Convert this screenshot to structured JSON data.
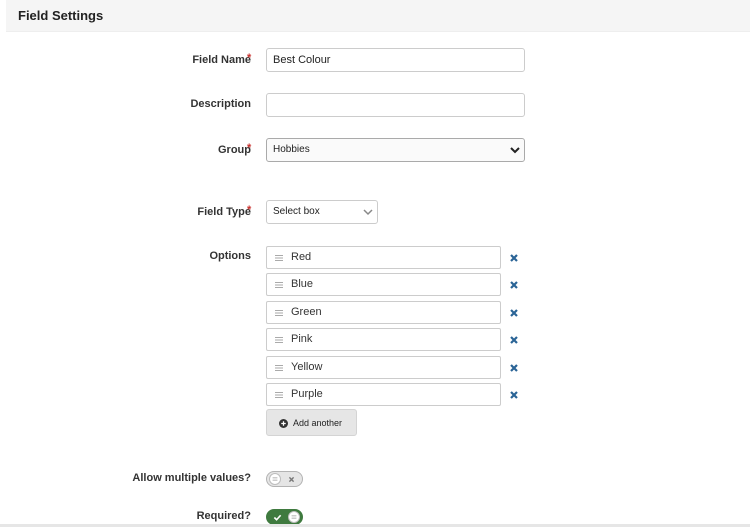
{
  "panel": {
    "title": "Field Settings"
  },
  "form": {
    "field_name": {
      "label": "Field Name",
      "required_mark": "*",
      "value": "Best Colour"
    },
    "description": {
      "label": "Description",
      "value": ""
    },
    "group": {
      "label": "Group",
      "required_mark": "*",
      "selected": "Hobbies"
    },
    "field_type": {
      "label": "Field Type",
      "required_mark": "*",
      "selected": "Select box"
    },
    "options": {
      "label": "Options",
      "items": [
        "Red",
        "Blue",
        "Green",
        "Pink",
        "Yellow",
        "Purple"
      ],
      "add_label": "Add another"
    },
    "allow_multiple": {
      "label": "Allow multiple values?",
      "enabled": false
    },
    "required": {
      "label": "Required?",
      "enabled": true
    }
  },
  "colors": {
    "required_star": "#c9302c",
    "toggle_on": "#3f7a3f",
    "remove_icon": "#2a6496"
  },
  "icons": {
    "chevron": "chevron-down-icon",
    "drag": "drag-handle-icon",
    "remove": "remove-icon",
    "add": "plus-circle-icon",
    "check": "check-icon",
    "close": "close-icon"
  }
}
